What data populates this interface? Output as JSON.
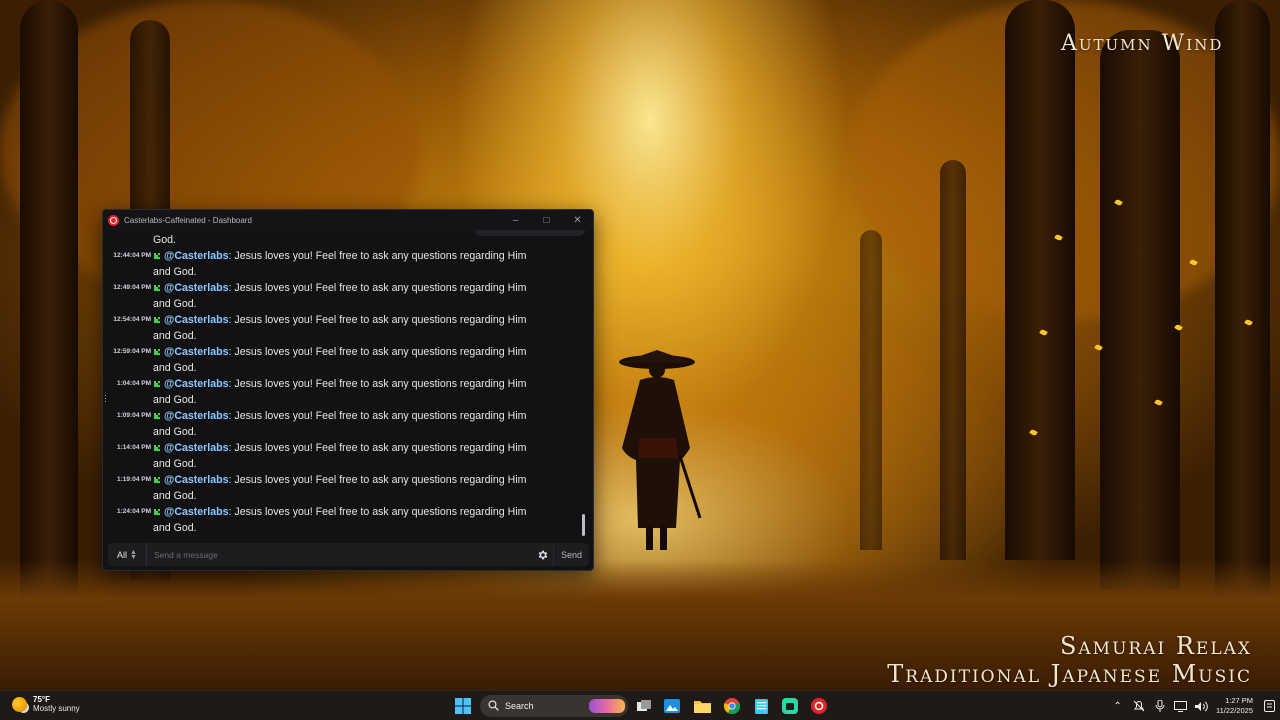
{
  "wallpaper": {
    "top_title": "Autumn Wind",
    "bottom_line1": "Samurai Relax",
    "bottom_line2": "Traditional Japanese Music"
  },
  "window": {
    "title": "Casterlabs-Caffeinated - Dashboard",
    "controls": [
      "minimize",
      "maximize",
      "close"
    ],
    "accent_color": "#e1242b"
  },
  "chat": {
    "first_partial_text": "God.",
    "messages": [
      {
        "time": "12:44:04 PM",
        "user": "@Casterlabs",
        "text": ": Jesus loves you! Feel free to ask any questions regarding Him and God."
      },
      {
        "time": "12:49:04 PM",
        "user": "@Casterlabs",
        "text": ": Jesus loves you! Feel free to ask any questions regarding Him and God."
      },
      {
        "time": "12:54:04 PM",
        "user": "@Casterlabs",
        "text": ": Jesus loves you! Feel free to ask any questions regarding Him and God."
      },
      {
        "time": "12:59:04 PM",
        "user": "@Casterlabs",
        "text": ": Jesus loves you! Feel free to ask any questions regarding Him and God."
      },
      {
        "time": "1:04:04 PM",
        "user": "@Casterlabs",
        "text": ": Jesus loves you! Feel free to ask any questions regarding Him and God."
      },
      {
        "time": "1:09:04 PM",
        "user": "@Casterlabs",
        "text": ": Jesus loves you! Feel free to ask any questions regarding Him and God."
      },
      {
        "time": "1:14:04 PM",
        "user": "@Casterlabs",
        "text": ": Jesus loves you! Feel free to ask any questions regarding Him and God."
      },
      {
        "time": "1:19:04 PM",
        "user": "@Casterlabs",
        "text": ": Jesus loves you! Feel free to ask any questions regarding Him and God."
      },
      {
        "time": "1:24:04 PM",
        "user": "@Casterlabs",
        "text": ": Jesus loves you! Feel free to ask any questions regarding Him and God."
      }
    ],
    "badge_icon": "green-puzzle-badge-icon",
    "username_color": "#8ec8ff"
  },
  "composer": {
    "platform": "All",
    "placeholder": "Send a message",
    "send_label": "Send"
  },
  "taskbar": {
    "weather_temp": "75°F",
    "weather_desc": "Mostly sunny",
    "search_label": "Search",
    "time": "1:27 PM",
    "date": "11/22/2025"
  }
}
